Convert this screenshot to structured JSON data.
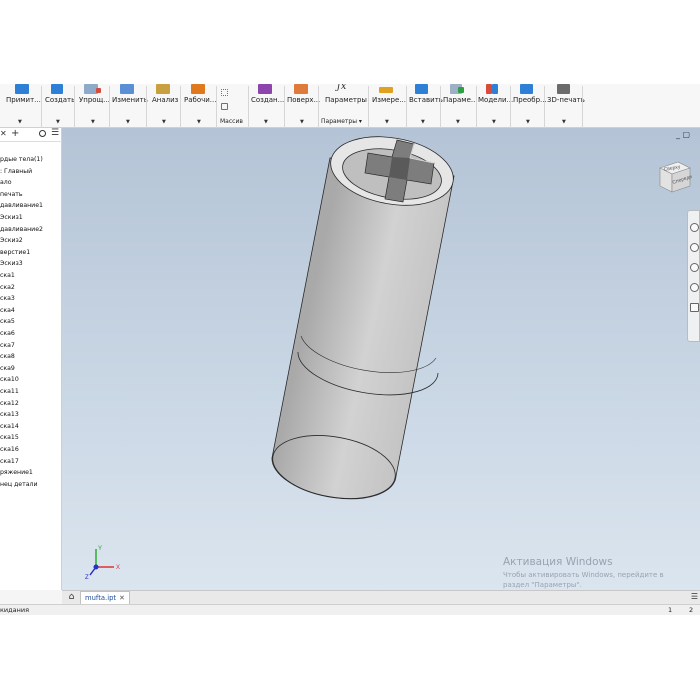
{
  "ribbon": {
    "items": [
      {
        "label": "Примит...",
        "icon": "primitive-icon",
        "color": "#2e7fd6"
      },
      {
        "label": "Создать",
        "icon": "create-icon",
        "color": "#2e7fd6"
      },
      {
        "label": "Упрощ...",
        "icon": "simplify-icon",
        "color": "#d84b3a"
      },
      {
        "label": "Изменить",
        "icon": "modify-icon",
        "color": "#5a8fd6"
      },
      {
        "label": "Анализ",
        "icon": "analysis-icon",
        "color": "#c8a040"
      },
      {
        "label": "Рабочи...",
        "icon": "work-features-icon",
        "color": "#e0781e"
      },
      {
        "label": "Массив",
        "icon": "pattern-icon",
        "color": "#2e7fd6"
      },
      {
        "label": "Создан...",
        "icon": "create-freeform-icon",
        "color": "#8e44ad"
      },
      {
        "label": "Поверх...",
        "icon": "surface-icon",
        "color": "#e07a3a"
      },
      {
        "label": "Параметры",
        "icon": "fx-parameters-icon",
        "color": "#333333"
      },
      {
        "label": "Измере...",
        "icon": "measure-icon",
        "color": "#e0a020"
      },
      {
        "label": "Вставить",
        "icon": "insert-icon",
        "color": "#2e7fd6"
      },
      {
        "label": "Параме...",
        "icon": "parameter-icon",
        "color": "#2ea043"
      },
      {
        "label": "Модели...",
        "icon": "model-icon",
        "color": "#d84b3a"
      },
      {
        "label": "Преобр...",
        "icon": "convert-icon",
        "color": "#2e7fd6"
      },
      {
        "label": "3D-печать",
        "icon": "3d-print-icon",
        "color": "#555555"
      }
    ],
    "group_labels": {
      "massiv": "Массив",
      "parametry": "Параметры ▾"
    }
  },
  "browser": {
    "items": [
      "рдые тела(1)",
      ": Главный",
      "ало",
      "печать",
      "давливание1",
      "Эскиз1",
      "давливание2",
      "Эскиз2",
      "верстие1",
      "Эскиз3",
      "ска1",
      "ска2",
      "ска3",
      "ска4",
      "ска5",
      "ска6",
      "ска7",
      "ска8",
      "ска9",
      "ска10",
      "ска11",
      "ска12",
      "ска13",
      "ска14",
      "ска15",
      "ска16",
      "ска17",
      "ряжение1",
      "нец детали"
    ]
  },
  "viewcube": {
    "top_label": "Сверху",
    "front_label": "Спереди"
  },
  "triad": {
    "x": "X",
    "y": "Y",
    "z": "Z"
  },
  "watermark": {
    "line1": "Активация Windows",
    "line2": "Чтобы активировать Windows, перейдите в",
    "line3": "раздел \"Параметры\"."
  },
  "tabs": {
    "file_tab": "mufta.ipt",
    "close": "✕"
  },
  "status": {
    "text": "кидания",
    "num1": "1",
    "num2": "2"
  },
  "colors": {
    "viewport_top": "#b4c4d6",
    "viewport_bottom": "#dbe5ef",
    "model": "#c8c8c8",
    "tab_text": "#1a4e9a"
  }
}
